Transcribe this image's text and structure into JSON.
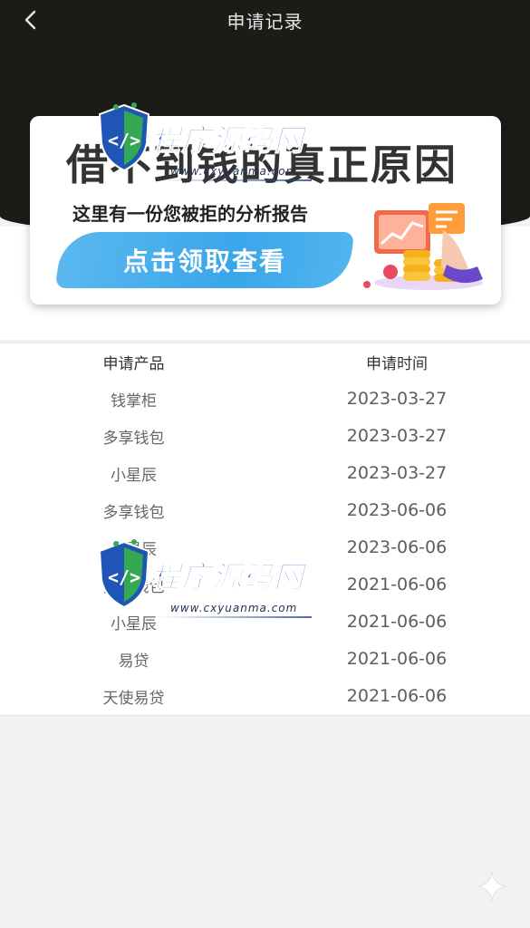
{
  "header": {
    "title": "申请记录"
  },
  "banner": {
    "headline": "借不到钱的真正原因",
    "subtitle": "这里有一份您被拒的分析报告",
    "cta_label": "点击领取查看"
  },
  "table": {
    "headers": {
      "product": "申请产品",
      "time": "申请时间"
    },
    "rows": [
      {
        "product": "钱掌柜",
        "time": "2023-03-27"
      },
      {
        "product": "多享钱包",
        "time": "2023-03-27"
      },
      {
        "product": "小星辰",
        "time": "2023-03-27"
      },
      {
        "product": "多享钱包",
        "time": "2023-06-06"
      },
      {
        "product": "小星辰",
        "time": "2023-06-06"
      },
      {
        "product": "多享钱包",
        "time": "2021-06-06"
      },
      {
        "product": "小星辰",
        "time": "2021-06-06"
      },
      {
        "product": "易贷",
        "time": "2021-06-06"
      },
      {
        "product": "天使易贷",
        "time": "2021-06-06"
      }
    ]
  },
  "watermark": {
    "part1": "程序",
    "part2": "源码网",
    "url": "www.cxyuanma.com"
  },
  "colors": {
    "header_bg": "#1c1b18",
    "cta_blue": "#3aa6ea",
    "watermark_blue": "#1f55b5"
  },
  "icons": {
    "back": "chevron-left-icon",
    "illustration": "finance-chart-coins-icon",
    "watermark": "code-shield-icon",
    "sparkle": "sparkle-icon"
  }
}
